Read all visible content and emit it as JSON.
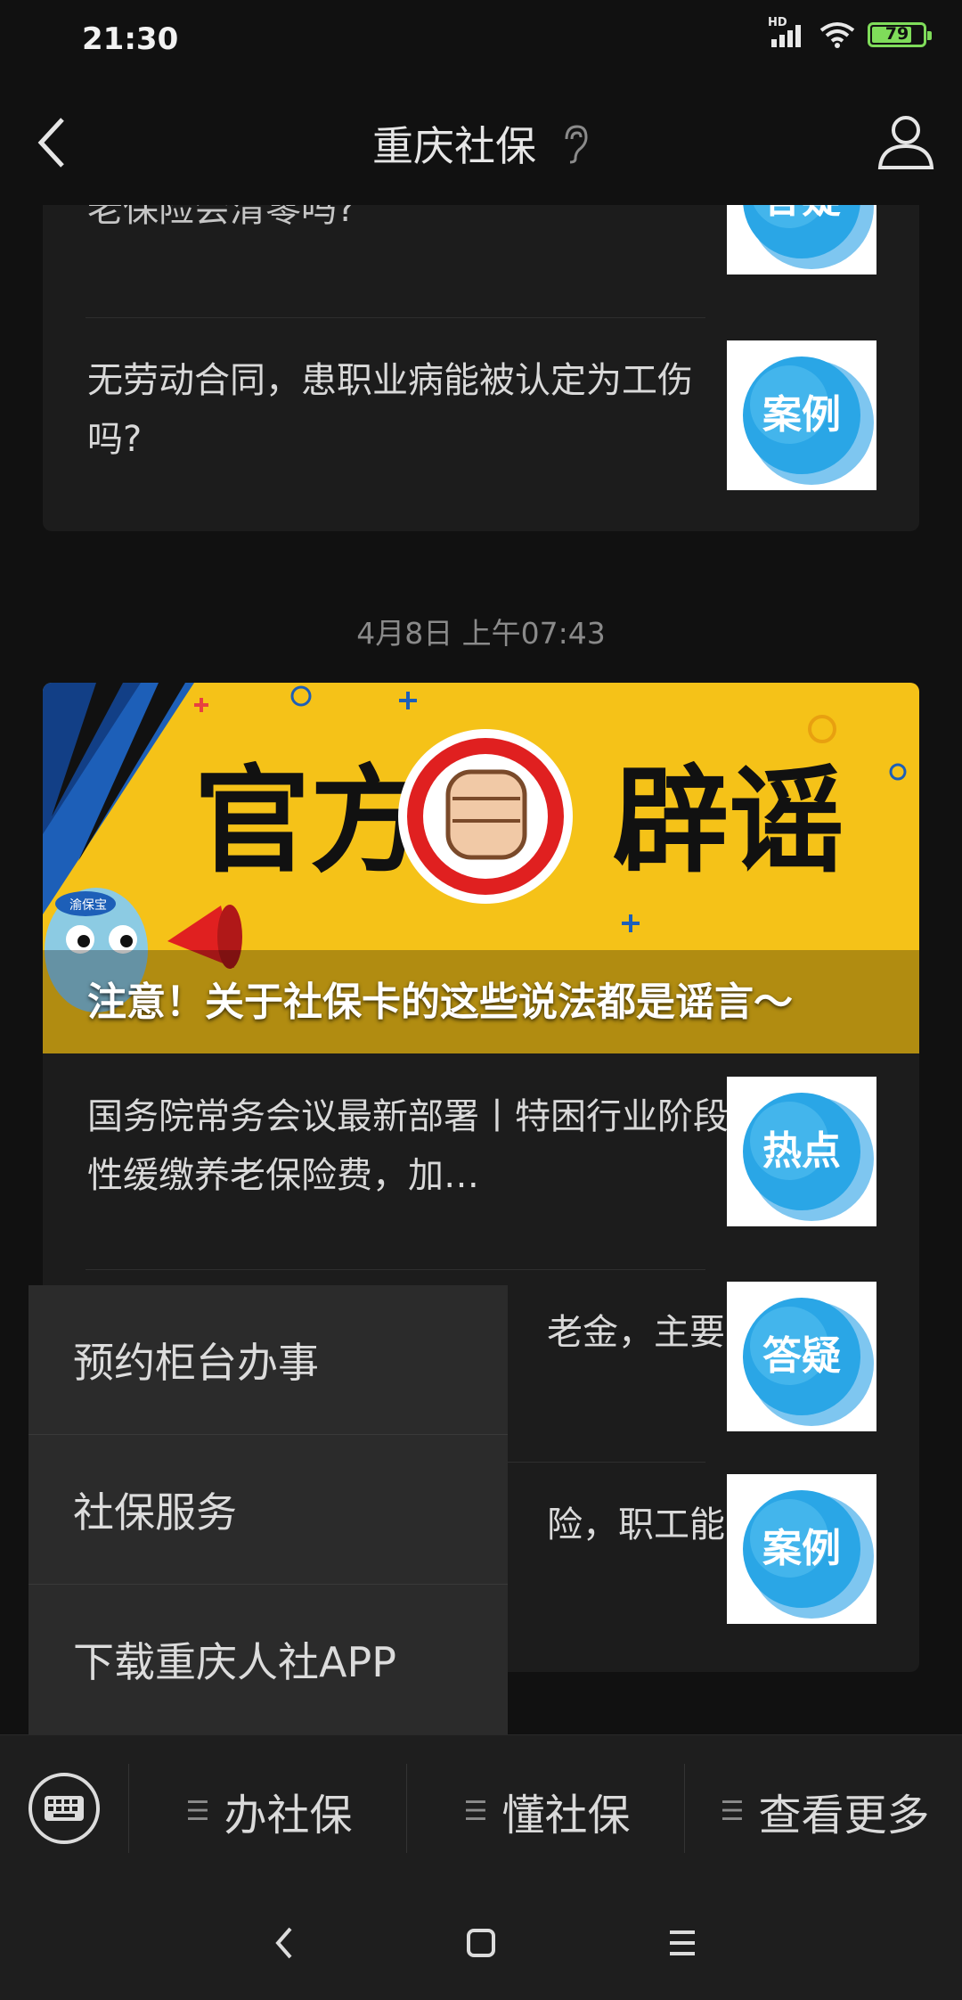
{
  "status_bar": {
    "time": "21:30",
    "network": "HD",
    "battery": "79",
    "battery_level": 0.79
  },
  "header": {
    "title": "重庆社保"
  },
  "feed": {
    "card1": {
      "articles": [
        {
          "title": "【……】……退休后长期外回地，养老保险会清零吗?",
          "visible_title_line": "老保险会清零吗?",
          "tag": "答疑"
        },
        {
          "title": "无劳动合同，患职业病能被认定为工伤吗?",
          "tag": "案例"
        }
      ]
    },
    "timestamp": "4月8日 上午07:43",
    "card2": {
      "banner": {
        "caption": "注意！关于社保卡的这些说法都是谣言～",
        "art_text": "官方辟谣",
        "mascot_badge": "渝保宝"
      },
      "articles": [
        {
          "title": "国务院常务会议最新部署丨特困行业阶段性缓缴养老保险费，加…",
          "tag": "热点"
        },
        {
          "visible_fragment": "老金，主要",
          "tag": "答疑"
        },
        {
          "visible_fragment": "险，职工能",
          "tag": "案例"
        }
      ]
    }
  },
  "popup_menu": {
    "items": [
      "预约柜台办事",
      "社保服务",
      "下载重庆人社APP"
    ]
  },
  "menu_bar": {
    "tabs": [
      "办社保",
      "懂社保",
      "查看更多"
    ]
  },
  "colors": {
    "background": "#111111",
    "card": "#1c1c1c",
    "popup": "#2b2b2b",
    "thumb_blue": "#2aa6e6",
    "banner_yellow": "#f5c218",
    "battery_green": "#7fdc5a"
  },
  "icons": [
    "back-arrow-icon",
    "ear-icon",
    "profile-icon",
    "keyboard-icon",
    "menu-lines-icon",
    "nav-back-icon",
    "nav-home-icon",
    "nav-menu-icon",
    "signal-icon",
    "wifi-icon",
    "battery-icon"
  ]
}
